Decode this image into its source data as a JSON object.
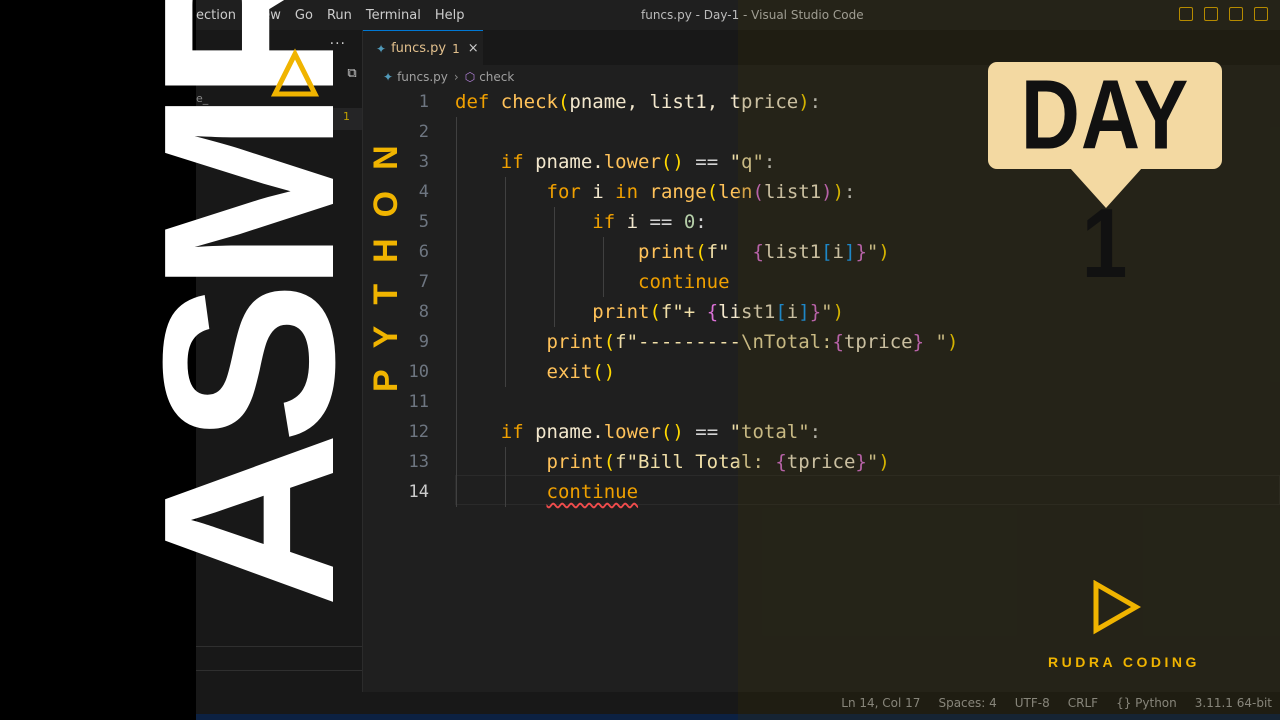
{
  "menu": [
    "ection",
    "View",
    "Go",
    "Run",
    "Terminal",
    "Help"
  ],
  "window_title": "funcs.py - Day-1 - Visual Studio Code",
  "sidebar": {
    "dots": "···",
    "badge": "1",
    "underscore": "e_"
  },
  "tab": {
    "name": "funcs.py",
    "problems": "1",
    "close": "×"
  },
  "breadcrumb": {
    "file": "funcs.py",
    "symbol": "check"
  },
  "code": [
    {
      "n": "1",
      "t": [
        [
          "kw",
          "def "
        ],
        [
          "fn",
          "check"
        ],
        [
          "br1",
          "("
        ],
        [
          "nm",
          "pname, list1, tprice"
        ],
        [
          "br1",
          ")"
        ],
        [
          "op",
          ":"
        ]
      ]
    },
    {
      "n": "2",
      "t": []
    },
    {
      "n": "3",
      "t": [
        [
          "kw",
          "    if "
        ],
        [
          "nm",
          "pname."
        ],
        [
          "fn",
          "lower"
        ],
        [
          "br1",
          "()"
        ],
        [
          "op",
          " == "
        ],
        [
          "st",
          "\"q\""
        ],
        [
          "op",
          ":"
        ]
      ]
    },
    {
      "n": "4",
      "t": [
        [
          "kw",
          "        for "
        ],
        [
          "nm",
          "i "
        ],
        [
          "kw",
          "in "
        ],
        [
          "fn",
          "range"
        ],
        [
          "br1",
          "("
        ],
        [
          "fn",
          "len"
        ],
        [
          "br2",
          "("
        ],
        [
          "nm",
          "list1"
        ],
        [
          "br2",
          ")"
        ],
        [
          "br1",
          ")"
        ],
        [
          "op",
          ":"
        ]
      ]
    },
    {
      "n": "5",
      "t": [
        [
          "kw",
          "            if "
        ],
        [
          "nm",
          "i "
        ],
        [
          "op",
          "== "
        ],
        [
          "num",
          "0"
        ],
        [
          "op",
          ":"
        ]
      ]
    },
    {
      "n": "6",
      "t": [
        [
          "fn",
          "                print"
        ],
        [
          "br1",
          "("
        ],
        [
          "st",
          "f\"  "
        ],
        [
          "br2",
          "{"
        ],
        [
          "nm",
          "list1"
        ],
        [
          "br3",
          "["
        ],
        [
          "nm",
          "i"
        ],
        [
          "br3",
          "]"
        ],
        [
          "br2",
          "}"
        ],
        [
          "st",
          "\""
        ],
        [
          "br1",
          ")"
        ]
      ]
    },
    {
      "n": "7",
      "t": [
        [
          "kw",
          "                continue"
        ]
      ]
    },
    {
      "n": "8",
      "t": [
        [
          "fn",
          "            print"
        ],
        [
          "br1",
          "("
        ],
        [
          "st",
          "f\"+ "
        ],
        [
          "br2",
          "{"
        ],
        [
          "nm",
          "list1"
        ],
        [
          "br3",
          "["
        ],
        [
          "nm",
          "i"
        ],
        [
          "br3",
          "]"
        ],
        [
          "br2",
          "}"
        ],
        [
          "st",
          "\""
        ],
        [
          "br1",
          ")"
        ]
      ]
    },
    {
      "n": "9",
      "t": [
        [
          "fn",
          "        print"
        ],
        [
          "br1",
          "("
        ],
        [
          "st",
          "f\"---------\\nTotal:"
        ],
        [
          "br2",
          "{"
        ],
        [
          "nm",
          "tprice"
        ],
        [
          "br2",
          "}"
        ],
        [
          "st",
          " \""
        ],
        [
          "br1",
          ")"
        ]
      ]
    },
    {
      "n": "10",
      "t": [
        [
          "fn",
          "        exit"
        ],
        [
          "br1",
          "()"
        ]
      ]
    },
    {
      "n": "11",
      "t": []
    },
    {
      "n": "12",
      "t": [
        [
          "kw",
          "    if "
        ],
        [
          "nm",
          "pname."
        ],
        [
          "fn",
          "lower"
        ],
        [
          "br1",
          "()"
        ],
        [
          "op",
          " == "
        ],
        [
          "st",
          "\"total\""
        ],
        [
          "op",
          ":"
        ]
      ]
    },
    {
      "n": "13",
      "t": [
        [
          "fn",
          "        print"
        ],
        [
          "br1",
          "("
        ],
        [
          "st",
          "f\"Bill Total: "
        ],
        [
          "br2",
          "{"
        ],
        [
          "nm",
          "tprice"
        ],
        [
          "br2",
          "}"
        ],
        [
          "st",
          "\""
        ],
        [
          "br1",
          ")"
        ]
      ]
    },
    {
      "n": "14",
      "t": [
        [
          "kw",
          "        "
        ],
        [
          "kw squig",
          "continue"
        ]
      ]
    }
  ],
  "status": [
    "Ln 14, Col 17",
    "Spaces: 4",
    "UTF-8",
    "CRLF",
    "{} Python",
    "3.11.1 64-bit"
  ],
  "overlay": {
    "asmr": "ASMR",
    "python": "PYTHON",
    "day": "DAY 1",
    "brand": "RUDRA CODING"
  },
  "colors": {
    "accent": "#f0b400",
    "bubble": "#f3d9a2",
    "editor_bg": "#1f1f1f"
  }
}
